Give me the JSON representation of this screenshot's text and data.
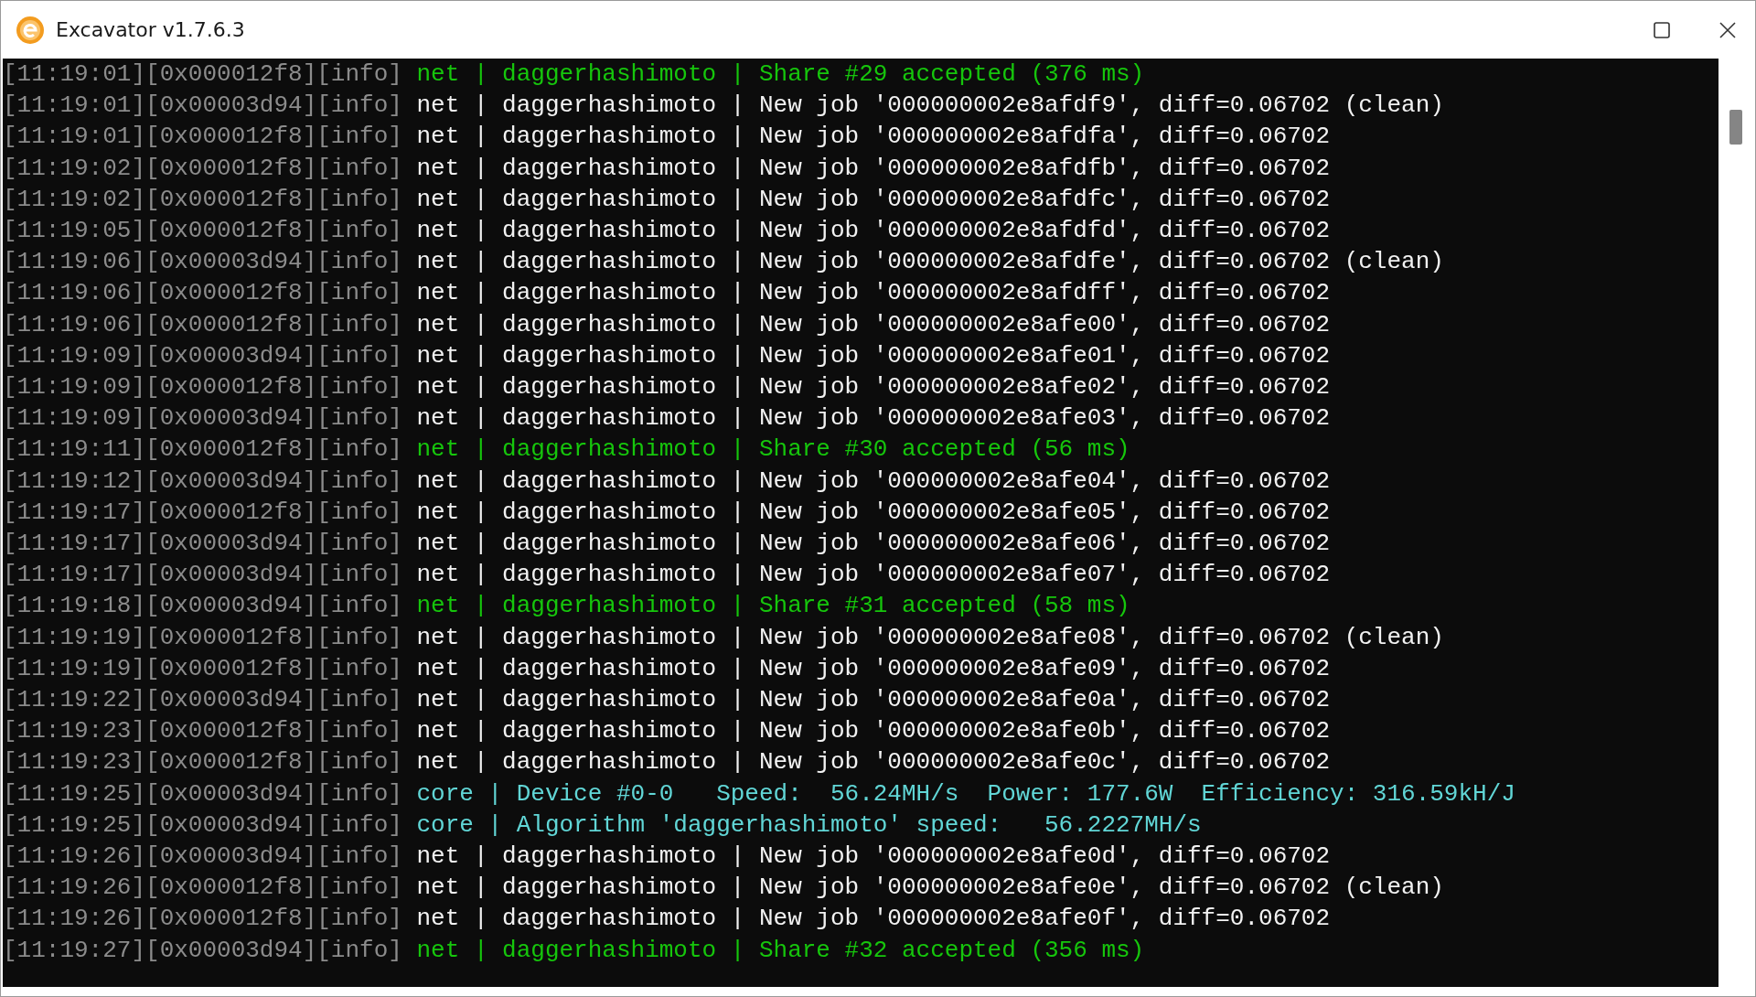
{
  "window": {
    "title": "Excavator v1.7.6.3"
  },
  "lines": [
    {
      "kind": "share",
      "prefix": "[11:19:01][0x000012f8][info]",
      "message": "net | daggerhashimoto | Share #29 accepted (376 ms)"
    },
    {
      "kind": "net",
      "prefix": "[11:19:01][0x00003d94][info]",
      "message": "net | daggerhashimoto | New job '000000002e8afdf9', diff=0.06702 (clean)"
    },
    {
      "kind": "net",
      "prefix": "[11:19:01][0x000012f8][info]",
      "message": "net | daggerhashimoto | New job '000000002e8afdfa', diff=0.06702"
    },
    {
      "kind": "net",
      "prefix": "[11:19:02][0x000012f8][info]",
      "message": "net | daggerhashimoto | New job '000000002e8afdfb', diff=0.06702"
    },
    {
      "kind": "net",
      "prefix": "[11:19:02][0x000012f8][info]",
      "message": "net | daggerhashimoto | New job '000000002e8afdfc', diff=0.06702"
    },
    {
      "kind": "net",
      "prefix": "[11:19:05][0x000012f8][info]",
      "message": "net | daggerhashimoto | New job '000000002e8afdfd', diff=0.06702"
    },
    {
      "kind": "net",
      "prefix": "[11:19:06][0x00003d94][info]",
      "message": "net | daggerhashimoto | New job '000000002e8afdfe', diff=0.06702 (clean)"
    },
    {
      "kind": "net",
      "prefix": "[11:19:06][0x000012f8][info]",
      "message": "net | daggerhashimoto | New job '000000002e8afdff', diff=0.06702"
    },
    {
      "kind": "net",
      "prefix": "[11:19:06][0x000012f8][info]",
      "message": "net | daggerhashimoto | New job '000000002e8afe00', diff=0.06702"
    },
    {
      "kind": "net",
      "prefix": "[11:19:09][0x00003d94][info]",
      "message": "net | daggerhashimoto | New job '000000002e8afe01', diff=0.06702"
    },
    {
      "kind": "net",
      "prefix": "[11:19:09][0x000012f8][info]",
      "message": "net | daggerhashimoto | New job '000000002e8afe02', diff=0.06702"
    },
    {
      "kind": "net",
      "prefix": "[11:19:09][0x00003d94][info]",
      "message": "net | daggerhashimoto | New job '000000002e8afe03', diff=0.06702"
    },
    {
      "kind": "share",
      "prefix": "[11:19:11][0x000012f8][info]",
      "message": "net | daggerhashimoto | Share #30 accepted (56 ms)"
    },
    {
      "kind": "net",
      "prefix": "[11:19:12][0x00003d94][info]",
      "message": "net | daggerhashimoto | New job '000000002e8afe04', diff=0.06702"
    },
    {
      "kind": "net",
      "prefix": "[11:19:17][0x000012f8][info]",
      "message": "net | daggerhashimoto | New job '000000002e8afe05', diff=0.06702"
    },
    {
      "kind": "net",
      "prefix": "[11:19:17][0x00003d94][info]",
      "message": "net | daggerhashimoto | New job '000000002e8afe06', diff=0.06702"
    },
    {
      "kind": "net",
      "prefix": "[11:19:17][0x00003d94][info]",
      "message": "net | daggerhashimoto | New job '000000002e8afe07', diff=0.06702"
    },
    {
      "kind": "share",
      "prefix": "[11:19:18][0x00003d94][info]",
      "message": "net | daggerhashimoto | Share #31 accepted (58 ms)"
    },
    {
      "kind": "net",
      "prefix": "[11:19:19][0x000012f8][info]",
      "message": "net | daggerhashimoto | New job '000000002e8afe08', diff=0.06702 (clean)"
    },
    {
      "kind": "net",
      "prefix": "[11:19:19][0x000012f8][info]",
      "message": "net | daggerhashimoto | New job '000000002e8afe09', diff=0.06702"
    },
    {
      "kind": "net",
      "prefix": "[11:19:22][0x00003d94][info]",
      "message": "net | daggerhashimoto | New job '000000002e8afe0a', diff=0.06702"
    },
    {
      "kind": "net",
      "prefix": "[11:19:23][0x000012f8][info]",
      "message": "net | daggerhashimoto | New job '000000002e8afe0b', diff=0.06702"
    },
    {
      "kind": "net",
      "prefix": "[11:19:23][0x000012f8][info]",
      "message": "net | daggerhashimoto | New job '000000002e8afe0c', diff=0.06702"
    },
    {
      "kind": "core",
      "prefix": "[11:19:25][0x00003d94][info]",
      "message": "core | Device #0-0   Speed:  56.24MH/s  Power: 177.6W  Efficiency: 316.59kH/J"
    },
    {
      "kind": "core",
      "prefix": "[11:19:25][0x00003d94][info]",
      "message": "core | Algorithm 'daggerhashimoto' speed:   56.2227MH/s"
    },
    {
      "kind": "net",
      "prefix": "[11:19:26][0x00003d94][info]",
      "message": "net | daggerhashimoto | New job '000000002e8afe0d', diff=0.06702"
    },
    {
      "kind": "net",
      "prefix": "[11:19:26][0x000012f8][info]",
      "message": "net | daggerhashimoto | New job '000000002e8afe0e', diff=0.06702 (clean)"
    },
    {
      "kind": "net",
      "prefix": "[11:19:26][0x000012f8][info]",
      "message": "net | daggerhashimoto | New job '000000002e8afe0f', diff=0.06702"
    },
    {
      "kind": "share",
      "prefix": "[11:19:27][0x00003d94][info]",
      "message": "net | daggerhashimoto | Share #32 accepted (356 ms)"
    }
  ]
}
